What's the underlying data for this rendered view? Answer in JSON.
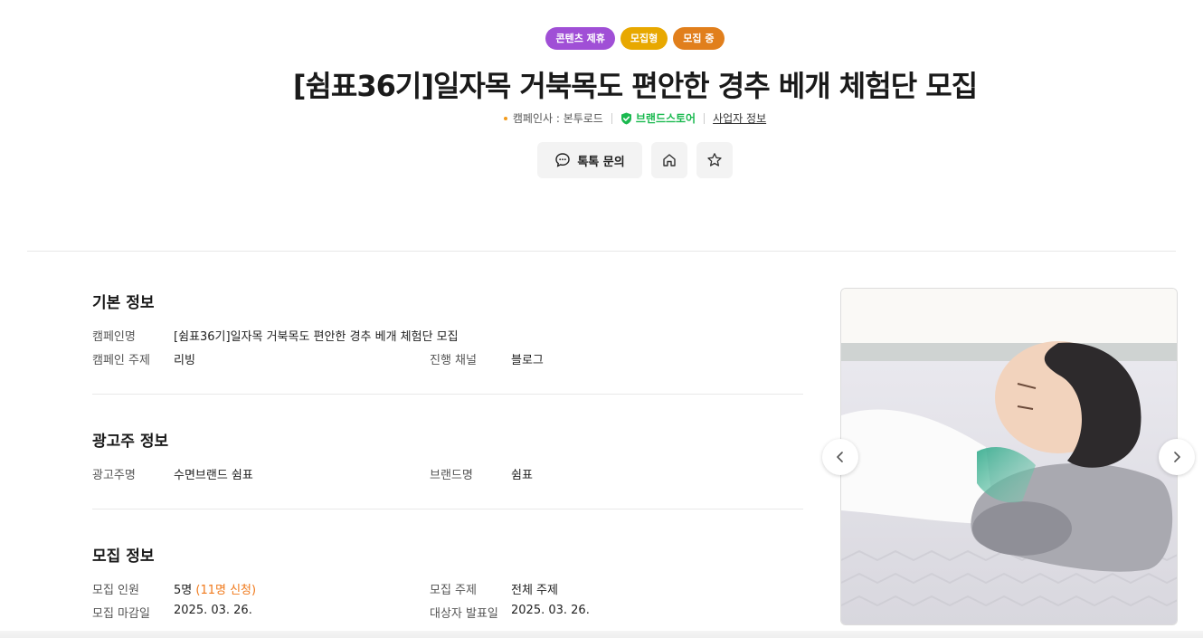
{
  "badges": [
    "콘텐츠 제휴",
    "모집형",
    "모집 중"
  ],
  "title": "[쉼표36기]일자목 거북목도 편안한 경추 베개 체험단 모집",
  "meta": {
    "campaign_company": "캠페인사 : 본투로드",
    "brand_store": "브랜드스토어",
    "business_info": "사업자 정보"
  },
  "actions": {
    "talk_label": "톡톡 문의",
    "home_icon": "home-icon",
    "favorite_icon": "star-icon"
  },
  "sections": {
    "basic": {
      "heading": "기본 정보",
      "campaign_name_label": "캠페인명",
      "campaign_name": "[쉼표36기]일자목 거북목도 편안한 경추 베개 체험단 모집",
      "topic_label": "캠페인 주제",
      "topic": "리빙",
      "channel_label": "진행 채널",
      "channel": "블로그"
    },
    "advertiser": {
      "heading": "광고주 정보",
      "advertiser_label": "광고주명",
      "advertiser": "수면브랜드 쉼표",
      "brand_label": "브랜드명",
      "brand": "쉼표"
    },
    "recruit": {
      "heading": "모집 정보",
      "people_label": "모집 인원",
      "people": "5명",
      "applied": "(11명 신청)",
      "subject_label": "모집 주제",
      "subject": "전체 주제",
      "deadline_label": "모집 마감일",
      "deadline": "2025. 03. 26.",
      "announce_label": "대상자 발표일",
      "announce": "2025. 03. 26."
    }
  },
  "colors": {
    "badge_content": "#a04fd6",
    "badge_type": "#e8a800",
    "badge_status": "#e17f1c",
    "brand_green": "#1ab94f",
    "highlight_orange": "#f07a1c"
  }
}
